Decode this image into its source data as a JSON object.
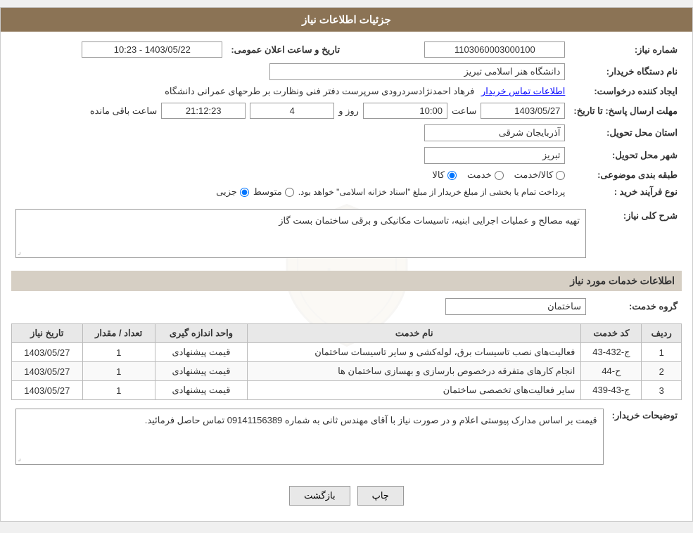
{
  "page": {
    "header": "جزئیات اطلاعات نیاز",
    "sections": {
      "details_label": "جزئیات اطلاعات نیاز",
      "services_label": "اطلاعات خدمات مورد نیاز"
    }
  },
  "fields": {
    "need_number_label": "شماره نیاز:",
    "need_number_value": "1103060003000100",
    "buyer_org_label": "نام دستگاه خریدار:",
    "buyer_org_value": "دانشگاه هنر اسلامی تبریز",
    "requester_label": "ایجاد کننده درخواست:",
    "requester_name": "فرهاد احمدنژادسردرودی سرپرست دفتر فنی ونظارت بر طرحهای عمرانی دانشگاه",
    "requester_link": "اطلاعات تماس خریدار",
    "response_deadline_label": "مهلت ارسال پاسخ: تا تاریخ:",
    "response_date": "1403/05/27",
    "response_time_label": "ساعت",
    "response_time": "10:00",
    "response_days_label": "روز و",
    "response_days": "4",
    "response_remaining_label": "ساعت باقی مانده",
    "response_remaining": "21:12:23",
    "province_label": "استان محل تحویل:",
    "province_value": "آذربایجان شرقی",
    "city_label": "شهر محل تحویل:",
    "city_value": "تبریز",
    "category_label": "طبقه بندی موضوعی:",
    "category_kala": "کالا",
    "category_khedmat": "خدمت",
    "category_kala_khedmat": "کالا/خدمت",
    "purchase_type_label": "نوع فرآیند خرید :",
    "purchase_type_jozi": "جزیی",
    "purchase_type_motevaset": "متوسط",
    "purchase_type_note": "پرداخت تمام یا بخشی از مبلغ خریدار از مبلغ \"اسناد خزانه اسلامی\" خواهد بود.",
    "announce_date_label": "تاریخ و ساعت اعلان عمومی:",
    "announce_date_value": "1403/05/22 - 10:23",
    "description_label": "شرح کلی نیاز:",
    "description_value": "تهیه مصالح و عملیات اجرایی ابنیه، تاسیسات مکانیکی و برقی ساختمان بست گاز",
    "service_group_label": "گروه خدمت:",
    "service_group_value": "ساختمان",
    "buyer_notes_label": "توضیحات خریدار:",
    "buyer_notes_value": "قیمت بر اساس مدارک پیوستی اعلام و در صورت نیاز با آقای مهندس ثانی به شماره 09141156389 تماس حاصل فرمائید.",
    "table_headers": {
      "row_num": "ردیف",
      "service_code": "کد خدمت",
      "service_name": "نام خدمت",
      "unit": "واحد اندازه گیری",
      "quantity": "تعداد / مقدار",
      "date": "تاریخ نیاز"
    },
    "table_rows": [
      {
        "row_num": "1",
        "service_code": "ج-432-43",
        "service_name": "فعالیت‌های نصب تاسیسات برق، لوله‌کشی و سایر تاسیسات ساختمان",
        "unit": "قیمت پیشنهادی",
        "quantity": "1",
        "date": "1403/05/27"
      },
      {
        "row_num": "2",
        "service_code": "ح-44",
        "service_name": "انجام کارهای متفرقه درخصوص بارسازی و بهسازی ساختمان ها",
        "unit": "قیمت پیشنهادی",
        "quantity": "1",
        "date": "1403/05/27"
      },
      {
        "row_num": "3",
        "service_code": "ج-43-439",
        "service_name": "سایر فعالیت‌های تخصصی ساختمان",
        "unit": "قیمت پیشنهادی",
        "quantity": "1",
        "date": "1403/05/27"
      }
    ],
    "buttons": {
      "back": "بازگشت",
      "print": "چاپ"
    }
  }
}
